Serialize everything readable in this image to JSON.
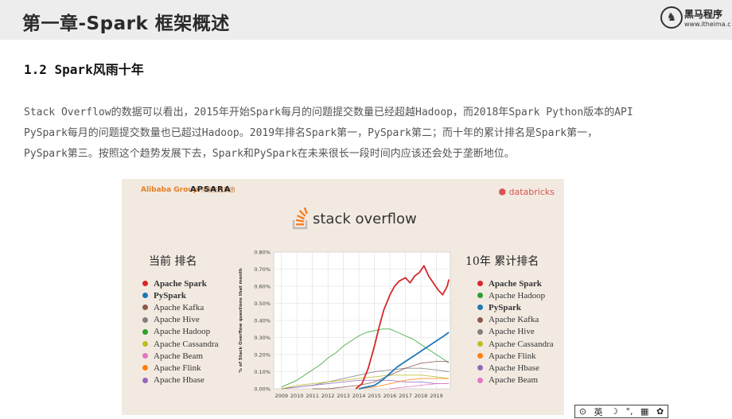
{
  "header": {
    "chapter_title": "第一章-Spark 框架概述",
    "logo_name": "黑马程序",
    "logo_url": "www.itheima.c"
  },
  "section_heading": "1.2 Spark风雨十年",
  "paragraph_lines": [
    "Stack Overflow的数据可以看出，2015年开始Spark每月的问题提交数量已经超越Hadoop，而2018年Spark Python版本的API",
    "PySpark每月的问题提交数量也已超过Hadoop。2019年排名Spark第一，PySpark第二；而十年的累计排名是Spark第一，",
    "PySpark第三。按照这个趋势发展下去，Spark和PySpark在未来很长一段时间内应该还会处于垄断地位。"
  ],
  "figure": {
    "alibaba": "Alibaba Group",
    "alibaba_sub": "阿里巴巴集团",
    "apsara": "APSARA",
    "databricks": "databricks",
    "stackoverflow_brand": "stack overflow",
    "legend_current_title": "当前 排名",
    "legend_total_title": "10年 累计排名",
    "legend_current": [
      {
        "name": "Apache Spark",
        "color": "#d62728",
        "bold": true
      },
      {
        "name": "PySpark",
        "color": "#1f77b4",
        "bold": true
      },
      {
        "name": "Apache Kafka",
        "color": "#8c564b",
        "bold": false
      },
      {
        "name": "Apache Hive",
        "color": "#7f7f7f",
        "bold": false
      },
      {
        "name": "Apache Hadoop",
        "color": "#2ca02c",
        "bold": false
      },
      {
        "name": "Apache Cassandra",
        "color": "#bcbd22",
        "bold": false
      },
      {
        "name": "Apache Beam",
        "color": "#e377c2",
        "bold": false
      },
      {
        "name": "Apache Flink",
        "color": "#ff7f0e",
        "bold": false
      },
      {
        "name": "Apache Hbase",
        "color": "#9467bd",
        "bold": false
      }
    ],
    "legend_total": [
      {
        "name": "Apache Spark",
        "color": "#d62728",
        "bold": true
      },
      {
        "name": "Apache Hadoop",
        "color": "#2ca02c",
        "bold": false
      },
      {
        "name": "PySpark",
        "color": "#1f77b4",
        "bold": true
      },
      {
        "name": "Apache Kafka",
        "color": "#8c564b",
        "bold": false
      },
      {
        "name": "Apache Hive",
        "color": "#7f7f7f",
        "bold": false
      },
      {
        "name": "Apache Cassandra",
        "color": "#bcbd22",
        "bold": false
      },
      {
        "name": "Apache Flink",
        "color": "#ff7f0e",
        "bold": false
      },
      {
        "name": "Apache Hbase",
        "color": "#9467bd",
        "bold": false
      },
      {
        "name": "Apache Beam",
        "color": "#e377c2",
        "bold": false
      }
    ]
  },
  "chart_data": {
    "type": "line",
    "title": "",
    "xlabel": "",
    "ylabel": "% of Stack Overflow questions that month",
    "xlim": [
      2008.5,
      2019.9
    ],
    "ylim": [
      0,
      0.8
    ],
    "x_ticks": [
      "2009",
      "2010",
      "2011",
      "2012",
      "2013",
      "2014",
      "2015",
      "2016",
      "2017",
      "2018",
      "2019"
    ],
    "y_ticks": [
      "0.00%",
      "0.10%",
      "0.20%",
      "0.30%",
      "0.40%",
      "0.50%",
      "0.60%",
      "0.70%",
      "0.80%"
    ],
    "grid": true,
    "series": [
      {
        "name": "Apache Hadoop",
        "color": "#2ca02c",
        "x": [
          2009,
          2009.5,
          2010,
          2010.5,
          2011,
          2011.5,
          2012,
          2012.5,
          2013,
          2013.5,
          2014,
          2014.5,
          2015,
          2015.5,
          2016,
          2016.5,
          2017,
          2017.5,
          2018,
          2018.5,
          2019,
          2019.5,
          2019.8
        ],
        "y": [
          0.01,
          0.03,
          0.05,
          0.08,
          0.11,
          0.14,
          0.18,
          0.21,
          0.25,
          0.28,
          0.31,
          0.33,
          0.34,
          0.35,
          0.35,
          0.33,
          0.31,
          0.29,
          0.26,
          0.23,
          0.2,
          0.17,
          0.15
        ]
      },
      {
        "name": "Apache Hive",
        "color": "#7f7f7f",
        "x": [
          2009,
          2010,
          2011,
          2012,
          2013,
          2014,
          2015,
          2016,
          2017,
          2018,
          2019,
          2019.8
        ],
        "y": [
          0.0,
          0.01,
          0.02,
          0.04,
          0.06,
          0.08,
          0.1,
          0.11,
          0.12,
          0.12,
          0.11,
          0.1
        ]
      },
      {
        "name": "Apache Hbase",
        "color": "#9467bd",
        "x": [
          2009,
          2010,
          2011,
          2012,
          2013,
          2014,
          2015,
          2016,
          2017,
          2018,
          2019,
          2019.8
        ],
        "y": [
          0.0,
          0.01,
          0.02,
          0.03,
          0.04,
          0.05,
          0.05,
          0.05,
          0.04,
          0.04,
          0.03,
          0.03
        ]
      },
      {
        "name": "Apache Cassandra",
        "color": "#bcbd22",
        "x": [
          2009,
          2010,
          2011,
          2012,
          2013,
          2014,
          2015,
          2016,
          2017,
          2018,
          2019,
          2019.8
        ],
        "y": [
          0.0,
          0.02,
          0.03,
          0.04,
          0.05,
          0.06,
          0.07,
          0.08,
          0.08,
          0.08,
          0.07,
          0.06
        ]
      },
      {
        "name": "Apache Kafka",
        "color": "#8c564b",
        "x": [
          2011,
          2012,
          2013,
          2014,
          2015,
          2016,
          2017,
          2018,
          2019,
          2019.8
        ],
        "y": [
          0.0,
          0.0,
          0.01,
          0.02,
          0.04,
          0.08,
          0.12,
          0.15,
          0.16,
          0.16
        ]
      },
      {
        "name": "Apache Flink",
        "color": "#ff7f0e",
        "x": [
          2014,
          2015,
          2016,
          2017,
          2018,
          2019,
          2019.8
        ],
        "y": [
          0.0,
          0.01,
          0.03,
          0.05,
          0.06,
          0.06,
          0.06
        ]
      },
      {
        "name": "Apache Beam",
        "color": "#e377c2",
        "x": [
          2016,
          2017,
          2018,
          2019,
          2019.8
        ],
        "y": [
          0.0,
          0.01,
          0.02,
          0.03,
          0.03
        ]
      },
      {
        "name": "PySpark",
        "color": "#1f77b4",
        "x": [
          2014,
          2014.5,
          2015,
          2015.5,
          2016,
          2016.5,
          2017,
          2017.5,
          2018,
          2018.5,
          2019,
          2019.5,
          2019.8
        ],
        "y": [
          0.0,
          0.01,
          0.02,
          0.05,
          0.09,
          0.13,
          0.16,
          0.19,
          0.22,
          0.25,
          0.28,
          0.31,
          0.33
        ]
      },
      {
        "name": "Apache Spark",
        "color": "#d62728",
        "x": [
          2013.8,
          2014.2,
          2014.6,
          2015.0,
          2015.3,
          2015.6,
          2016.0,
          2016.3,
          2016.6,
          2017.0,
          2017.3,
          2017.6,
          2017.9,
          2018.2,
          2018.5,
          2018.8,
          2019.1,
          2019.4,
          2019.7,
          2019.8
        ],
        "y": [
          0.0,
          0.03,
          0.12,
          0.25,
          0.36,
          0.46,
          0.55,
          0.6,
          0.63,
          0.65,
          0.62,
          0.66,
          0.68,
          0.72,
          0.66,
          0.62,
          0.58,
          0.55,
          0.6,
          0.64
        ]
      }
    ]
  },
  "ime": {
    "lang": "英",
    "moon": "☽",
    "punct": "°,",
    "keyboard": "▦",
    "settings": "✿"
  }
}
